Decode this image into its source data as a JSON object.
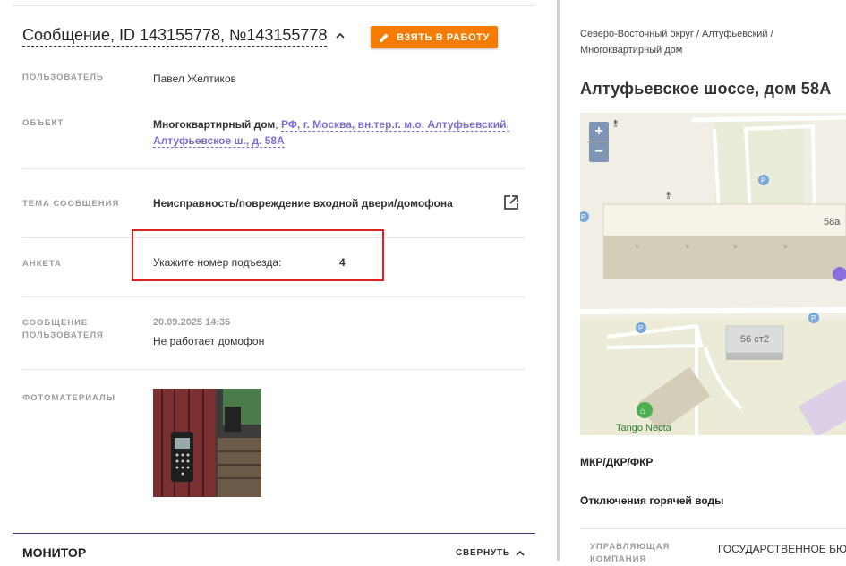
{
  "message": {
    "title": "Сообщение, ID 143155778, №143155778",
    "take_button": "ВЗЯТЬ В РАБОТУ"
  },
  "fields": {
    "user_label": "ПОЛЬЗОВАТЕЛЬ",
    "user_value": "Павел Желтиков",
    "object_label": "ОБЪЕКТ",
    "object_type": "Многоквартирный дом",
    "object_comma": ", ",
    "object_address_line1": "РФ, г. Москва, вн.тер.г. м.о. Алтуфьевский,",
    "object_address_line2": "Алтуфьевское ш., д. 58А",
    "topic_label": "ТЕМА СООБЩЕНИЯ",
    "topic_value": "Неисправность/повреждение входной двери/домофона",
    "survey_label": "АНКЕТА",
    "survey_question": "Укажите номер подъезда:",
    "survey_answer": "4",
    "user_message_label_1": "СООБЩЕНИЕ",
    "user_message_label_2": "ПОЛЬЗОВАТЕЛЯ",
    "user_message_date": "20.09.2025 14:35",
    "user_message_text": "Не работает домофон",
    "photos_label": "ФОТОМАТЕРИАЛЫ"
  },
  "monitor": {
    "title": "МОНИТОР",
    "collapse": "СВЕРНУТЬ"
  },
  "right": {
    "breadcrumb_line1": "Северо-Восточный округ / Алтуфьевский /",
    "breadcrumb_line2": "Многоквартирный дом",
    "address": "Алтуфьевское шоссе, дом 58А",
    "map": {
      "zoom_in": "+",
      "zoom_out": "−",
      "label_58a": "58а",
      "label_56": "56 ст2",
      "label_tango": "Tango Necta",
      "parking": "P"
    },
    "mkr": "МКР/ДКР/ФКР",
    "hot_water": "Отключения горячей воды",
    "uk_label_1": "УПРАВЛЯЮЩАЯ",
    "uk_label_2": "КОМПАНИЯ",
    "uk_value": "ГОСУДАРСТВЕННОЕ БЮДЖ"
  },
  "colors": {
    "accent": "#f57c00",
    "link": "#7a6fcf",
    "highlight": "#dd2222",
    "marker": "#8a6fe0"
  }
}
